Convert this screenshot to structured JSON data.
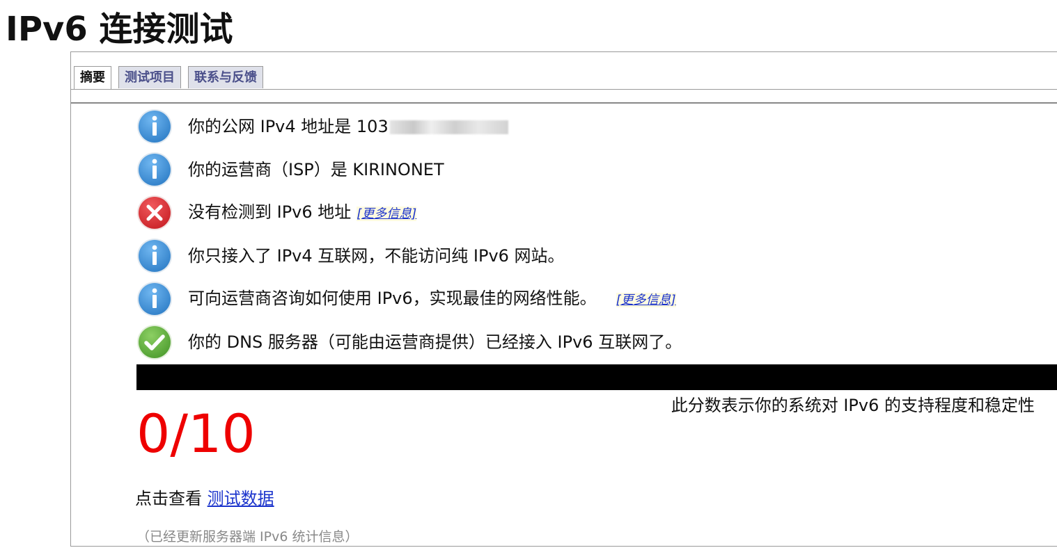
{
  "page": {
    "title": "IPv6 连接测试"
  },
  "tabs": [
    {
      "label": "摘要",
      "active": true
    },
    {
      "label": "测试项目",
      "active": false
    },
    {
      "label": "联系与反馈",
      "active": false
    }
  ],
  "results": [
    {
      "icon": "info-icon",
      "text": "你的公网 IPv4 地址是 103",
      "redacted": true
    },
    {
      "icon": "info-icon",
      "text": "你的运营商（ISP）是 KIRINONET"
    },
    {
      "icon": "error-icon",
      "text": "没有检测到 IPv6 地址",
      "link": "[更多信息]"
    },
    {
      "icon": "info-icon",
      "text": "你只接入了 IPv4 互联网，不能访问纯 IPv6 网站。"
    },
    {
      "icon": "info-icon",
      "text": "可向运营商咨询如何使用 IPv6，实现最佳的网络性能。",
      "link": "[更多信息]"
    },
    {
      "icon": "check-icon",
      "text": "你的 DNS 服务器（可能由运营商提供）已经接入 IPv6 互联网了。"
    }
  ],
  "score": {
    "value": "0/10",
    "description": "此分数表示你的系统对 IPv6 的支持程度和稳定性"
  },
  "view_data": {
    "prefix": "点击查看",
    "link": "测试数据"
  },
  "footnote": "（已经更新服务器端 IPv6 统计信息）",
  "colors": {
    "info": "#3d8fd6",
    "error": "#d6282d",
    "success": "#5cae3a",
    "score": "#ee0000",
    "link": "#1a33cc"
  }
}
